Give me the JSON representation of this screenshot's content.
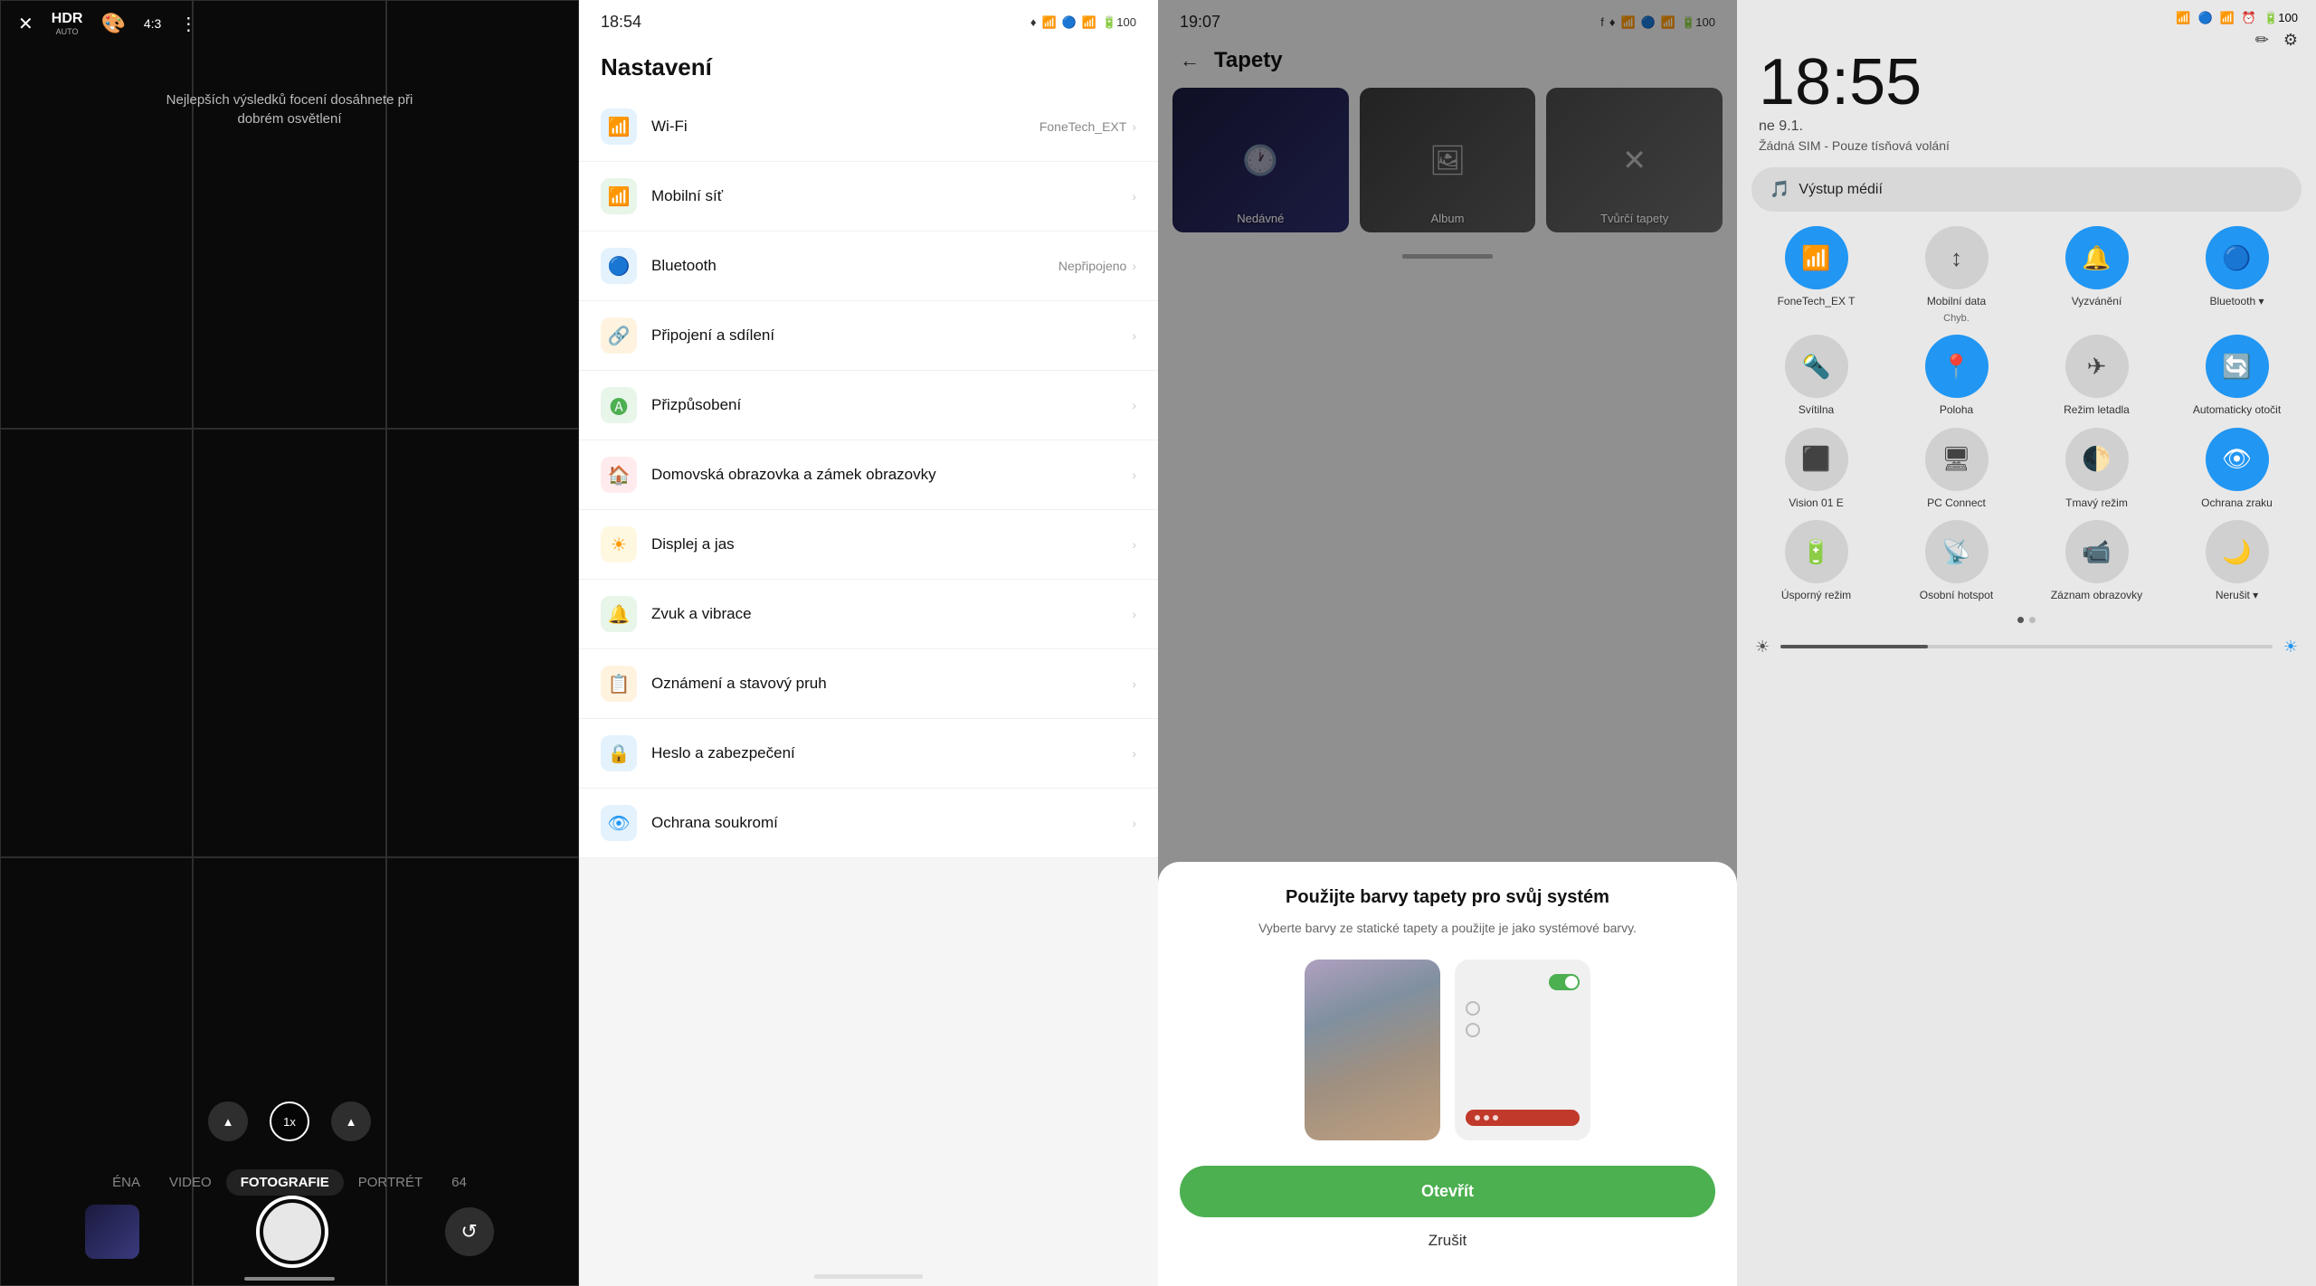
{
  "camera": {
    "top_icons": [
      "flash-off",
      "hdr",
      "color-wheel",
      "ratio-43",
      "more-vert"
    ],
    "hdr_label": "HDR",
    "hdr_sub": "AUTO",
    "ratio_label": "4:3",
    "focus_hint": "Nejlepších výsledků focení dosáhnete při dobrém osvětlení",
    "zoom_levels": [
      "▲",
      "1x",
      "▲"
    ],
    "zoom_active": "1x",
    "modes": [
      "ÉNA",
      "VIDEO",
      "FOTOGRAFIE",
      "PORTRÉT",
      "64"
    ],
    "active_mode": "FOTOGRAFIE",
    "bottom_bar_indicator": ""
  },
  "settings": {
    "status_time": "18:54",
    "status_pin": "♦",
    "title": "Nastavení",
    "items": [
      {
        "icon": "wifi",
        "color": "#2196F3",
        "label": "Wi-Fi",
        "value": "FoneTech_EXT"
      },
      {
        "icon": "signal",
        "color": "#4CAF50",
        "label": "Mobilní síť",
        "value": ""
      },
      {
        "icon": "bluetooth",
        "color": "#2196F3",
        "label": "Bluetooth",
        "value": "Nepřipojeno"
      },
      {
        "icon": "share",
        "color": "#FF6B35",
        "label": "Připojení a sdílení",
        "value": ""
      },
      {
        "icon": "letter-a",
        "color": "#4CAF50",
        "label": "Přizpůsobení",
        "value": ""
      },
      {
        "icon": "home",
        "color": "#E53935",
        "label": "Domovská obrazovka a zámek obrazovky",
        "value": ""
      },
      {
        "icon": "brightness",
        "color": "#FF9800",
        "label": "Displej a jas",
        "value": ""
      },
      {
        "icon": "volume",
        "color": "#4CAF50",
        "label": "Zvuk a vibrace",
        "value": ""
      },
      {
        "icon": "notification",
        "color": "#FF6B35",
        "label": "Oznámení a stavový pruh",
        "value": ""
      },
      {
        "icon": "lock",
        "color": "#2196F3",
        "label": "Heslo a zabezpečení",
        "value": ""
      },
      {
        "icon": "privacy",
        "color": "#2196F3",
        "label": "Ochrana soukromí",
        "value": ""
      }
    ]
  },
  "wallpaper": {
    "status_time": "19:07",
    "status_fb": "f",
    "status_loc": "♦",
    "back_label": "←",
    "title": "Tapety",
    "categories": [
      {
        "label": "Nedávné",
        "icon": "🕐"
      },
      {
        "label": "Album",
        "icon": "🖼"
      },
      {
        "label": "Tvůrčí tapety",
        "icon": "✕"
      }
    ],
    "dialog": {
      "title": "Použijte barvy tapety pro svůj systém",
      "desc": "Vyberte barvy ze statické tapety a použijte je jako systémové barvy.",
      "open_btn": "Otevřít",
      "cancel_btn": "Zrušit"
    }
  },
  "quick_settings": {
    "status_icons": [
      "SIM",
      "BT",
      "WiFi",
      "🔋100"
    ],
    "time": "18:55",
    "edit_icon": "✏",
    "settings_icon": "⚙",
    "date": "ne 9.1.",
    "sim_info": "Žádná SIM - Pouze tísňová volání",
    "media_output_label": "Výstup médií",
    "tiles": [
      {
        "icon": "📶",
        "label": "FoneTech_EX T",
        "sublabel": "",
        "active": true
      },
      {
        "icon": "↕",
        "label": "Mobilní data",
        "sublabel": "Chyb.",
        "active": false
      },
      {
        "icon": "🔔",
        "label": "Vyzvánění",
        "sublabel": "",
        "active": true
      },
      {
        "icon": "🔵",
        "label": "Bluetooth ▾",
        "sublabel": "",
        "active": true
      },
      {
        "icon": "🔦",
        "label": "Svítilna",
        "sublabel": "",
        "active": false
      },
      {
        "icon": "📍",
        "label": "Poloha",
        "sublabel": "",
        "active": true
      },
      {
        "icon": "✈",
        "label": "Režim letadla",
        "sublabel": "",
        "active": false
      },
      {
        "icon": "🔄",
        "label": "Automaticky otočit",
        "sublabel": "",
        "active": true
      },
      {
        "icon": "⬛",
        "label": "Vision 01 E",
        "sublabel": "",
        "active": false
      },
      {
        "icon": "🖥",
        "label": "PC Connect",
        "sublabel": "",
        "active": false
      },
      {
        "icon": "🌓",
        "label": "Tmavý režim",
        "sublabel": "",
        "active": false
      },
      {
        "icon": "👁",
        "label": "Ochrana zraku",
        "sublabel": "",
        "active": true
      },
      {
        "icon": "🔋",
        "label": "Úsporný režim",
        "sublabel": "",
        "active": false
      },
      {
        "icon": "📡",
        "label": "Osobní hotspot",
        "sublabel": "",
        "active": false
      },
      {
        "icon": "📹",
        "label": "Záznam obrazovky",
        "sublabel": "",
        "active": false
      },
      {
        "icon": "🌙",
        "label": "Nerušit ▾",
        "sublabel": "",
        "active": false
      }
    ],
    "dots": [
      true,
      false
    ],
    "brightness_level": 30
  }
}
